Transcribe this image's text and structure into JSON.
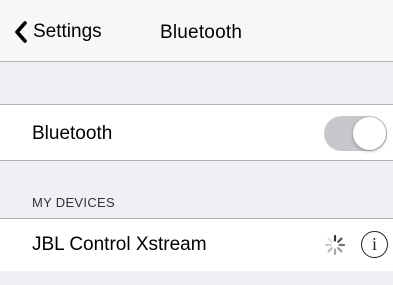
{
  "navbar": {
    "back_label": "Settings",
    "title": "Bluetooth",
    "back_icon": "chevron-left-icon"
  },
  "bluetooth_toggle": {
    "label": "Bluetooth",
    "state": "on",
    "track_color": "#c7c7cc"
  },
  "devices_section": {
    "header": "MY DEVICES",
    "devices": [
      {
        "name": "JBL Control Xstream",
        "status_icon": "loading-spinner-icon",
        "info_icon": "info-icon",
        "info_glyph": "i"
      }
    ]
  }
}
